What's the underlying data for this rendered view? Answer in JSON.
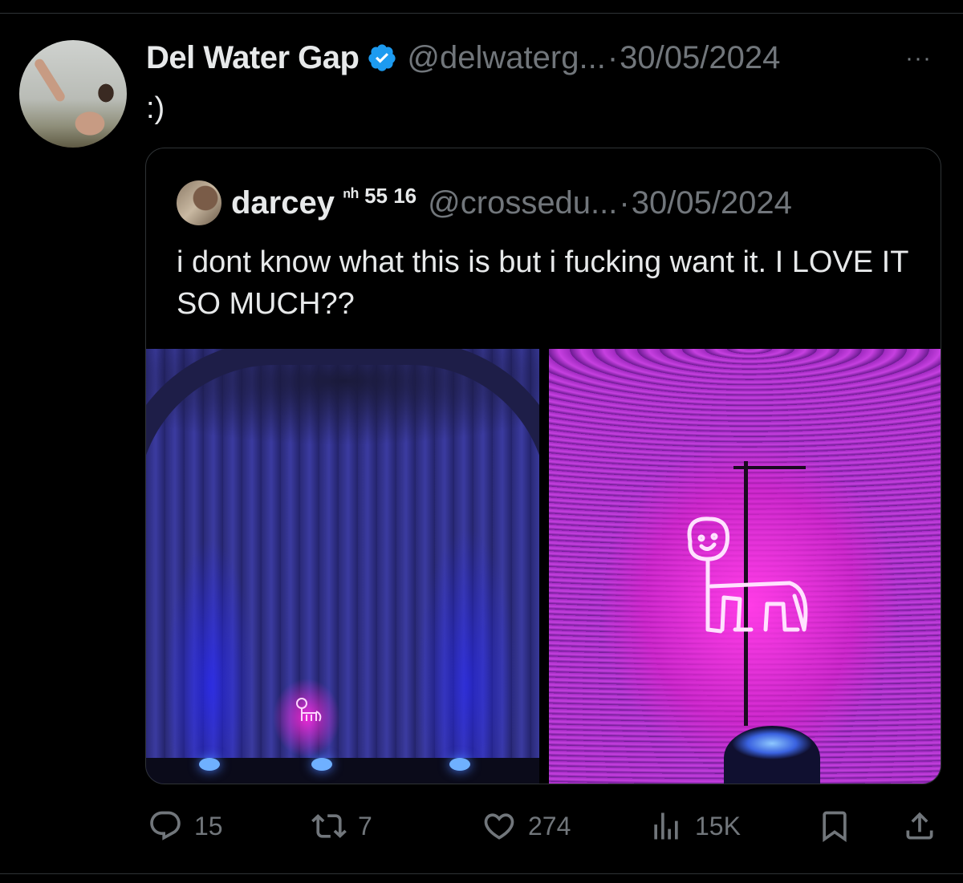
{
  "tweet": {
    "author_name": "Del Water Gap",
    "author_handle": "@delwaterg...",
    "separator": "·",
    "date": "30/05/2024",
    "more_label": "···",
    "text": ":)"
  },
  "quoted": {
    "author_name": "darcey",
    "badge": "ⁿʰ 55 16",
    "author_handle": "@crossedu...",
    "separator": "·",
    "date": "30/05/2024",
    "text": "i dont know what this is but i fucking want it. I LOVE IT SO MUCH??"
  },
  "actions": {
    "replies": "15",
    "reposts": "7",
    "likes": "274",
    "views": "15K"
  },
  "colors": {
    "background": "#000000",
    "text_primary": "#e7e9ea",
    "text_secondary": "#71767b",
    "border": "#2f3336",
    "verified": "#1d9bf0"
  },
  "icons": [
    "reply-icon",
    "retweet-icon",
    "like-icon",
    "views-icon",
    "bookmark-icon",
    "share-icon",
    "verified-badge-icon",
    "more-icon"
  ]
}
